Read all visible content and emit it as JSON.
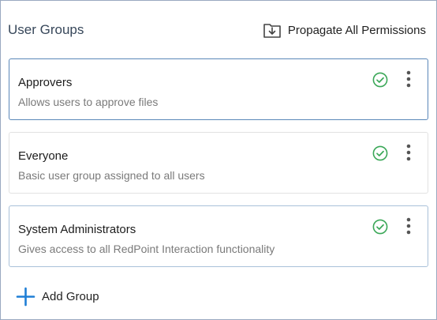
{
  "header": {
    "title": "User Groups",
    "propagate_label": "Propagate All Permissions",
    "propagate_icon": "folder-download-icon"
  },
  "groups": [
    {
      "name": "Approvers",
      "description": "Allows users to approve files",
      "status_icon": "check-circle-icon",
      "state": "selected"
    },
    {
      "name": "Everyone",
      "description": "Basic user group assigned to all users",
      "status_icon": "check-circle-icon",
      "state": "default"
    },
    {
      "name": "System Administrators",
      "description": "Gives access to all RedPoint Interaction functionality",
      "status_icon": "check-circle-icon",
      "state": "outlined"
    }
  ],
  "footer": {
    "add_label": "Add Group",
    "add_icon": "plus-icon"
  },
  "colors": {
    "check_green": "#3aa757",
    "accent_blue": "#1f7fd6",
    "selected_border": "#5a87b8"
  }
}
